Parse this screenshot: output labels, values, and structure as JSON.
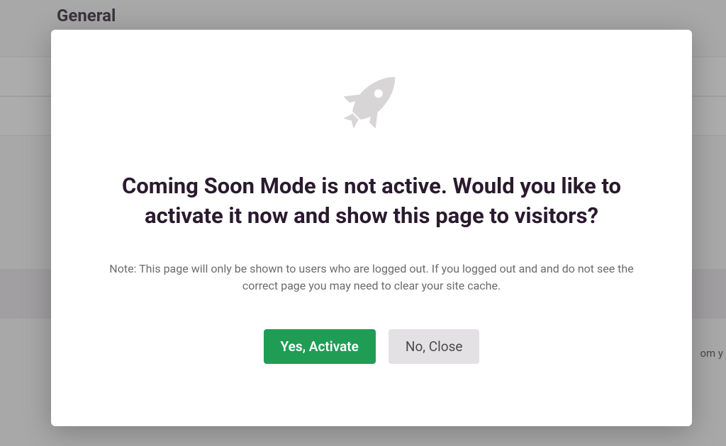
{
  "background": {
    "heading": "General",
    "fragment_text": "om y"
  },
  "modal": {
    "icon": "rocket-icon",
    "title": "Coming Soon Mode is not active. Would you like to activate it now and show this page to visitors?",
    "note": "Note: This page will only be shown to users who are logged out. If you logged out and and do not see the correct page you may need to clear your site cache.",
    "actions": {
      "confirm_label": "Yes, Activate",
      "cancel_label": "No, Close"
    }
  },
  "colors": {
    "primary_button": "#1f9d55",
    "secondary_button": "#e4e1e4",
    "heading_text": "#2a1a2e",
    "muted_text": "#6b6b6b",
    "icon": "#d8d5d7"
  }
}
